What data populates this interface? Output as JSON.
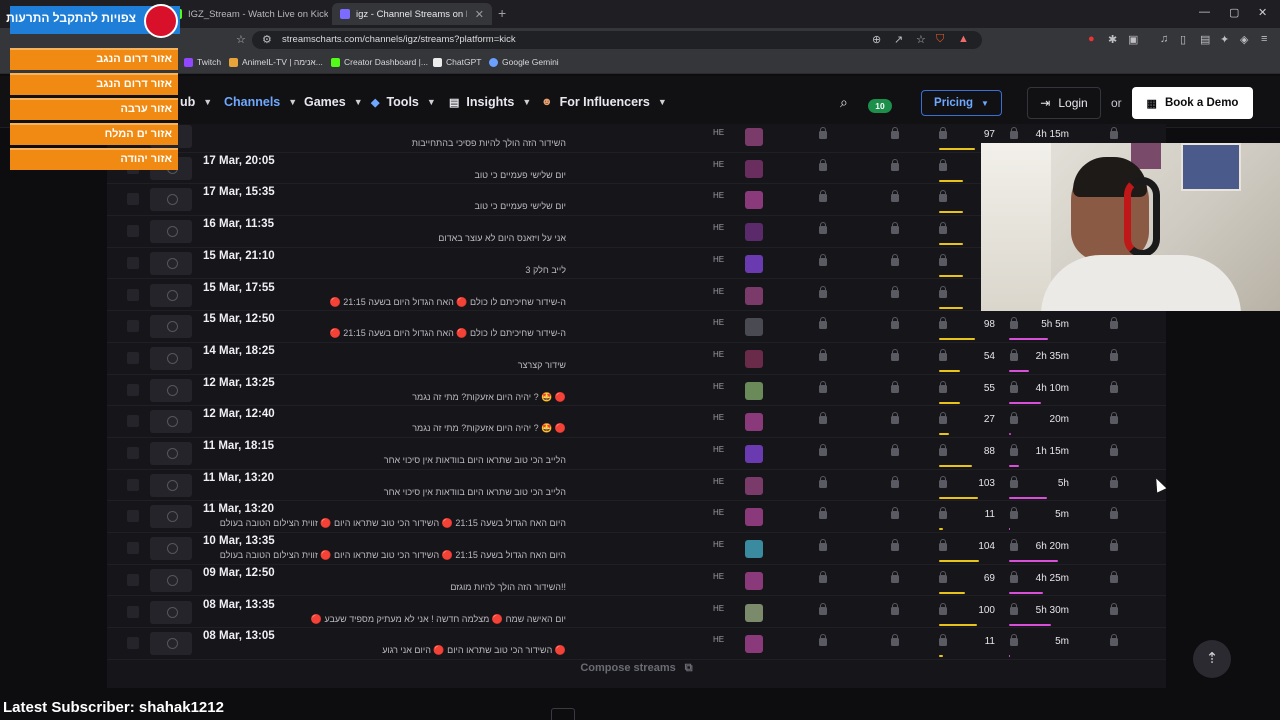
{
  "browser": {
    "tabs": [
      {
        "label": "IGZ_Stream - Watch Live on Kick",
        "active": false,
        "favicon_color": "#53fc18"
      },
      {
        "label": "igz - Channel Streams on Kick V",
        "active": true,
        "favicon_color": "#7b6cff"
      }
    ],
    "url": "streamscharts.com/channels/igz/streams?platform=kick",
    "bookmarks": [
      "Twitch",
      "AnimeIL-TV | אנימה...",
      "Creator Dashboard |...",
      "ChatGPT",
      "Google Gemini"
    ]
  },
  "site_nav": {
    "partial_item": "ub",
    "items": [
      "Channels",
      "Games",
      "Tools",
      "Insights",
      "For Influencers"
    ],
    "active_item": "Channels",
    "notification_count": "10",
    "pricing_label": "Pricing",
    "login_label": "Login",
    "or_label": "or",
    "demo_label": "Book a Demo"
  },
  "table": {
    "rows": [
      {
        "date": "",
        "title": "השידור הזה הולך להיות פסיכי בהתחייבות",
        "lang": "HE",
        "viewers": "97",
        "duration": "4h 15m",
        "avatar": "#7a3a6a",
        "vbar": 0.6,
        "dbar": 0.55
      },
      {
        "date": "17 Mar, 20:05",
        "title": "יום שלישי פעמיים כי טוב",
        "lang": "HE",
        "viewers": "",
        "duration": "",
        "avatar": "#6a2e5e",
        "vbar": 0.4,
        "dbar": 0.3
      },
      {
        "date": "17 Mar, 15:35",
        "title": "יום שלישי פעמיים כי טוב",
        "lang": "HE",
        "viewers": "",
        "duration": "",
        "avatar": "#8a3a7a",
        "vbar": 0.4,
        "dbar": 0.3
      },
      {
        "date": "16 Mar, 11:35",
        "title": "אני על ויזאנס היום לא עוצר באדום",
        "lang": "HE",
        "viewers": "",
        "duration": "",
        "avatar": "#5a2a6a",
        "vbar": 0.4,
        "dbar": 0.3
      },
      {
        "date": "15 Mar, 21:10",
        "title": "לייב חלק 3",
        "lang": "HE",
        "viewers": "",
        "duration": "",
        "avatar": "#6a3ab0",
        "vbar": 0.4,
        "dbar": 0.3
      },
      {
        "date": "15 Mar, 17:55",
        "title": "ה-שידור שחיכיתם לו כולם 🔴 האח הגדול היום בשעה 21:15 🔴",
        "lang": "HE",
        "viewers": "",
        "duration": "",
        "avatar": "#7a3a6a",
        "vbar": 0.4,
        "dbar": 0.3
      },
      {
        "date": "15 Mar, 12:50",
        "title": "ה-שידור שחיכיתם לו כולם 🔴 האח הגדול היום בשעה 21:15 🔴",
        "lang": "HE",
        "viewers": "98",
        "duration": "5h 5m",
        "avatar": "#4a4a52",
        "vbar": 0.6,
        "dbar": 0.65
      },
      {
        "date": "14 Mar, 18:25",
        "title": "שידור קצרצר",
        "lang": "HE",
        "viewers": "54",
        "duration": "2h 35m",
        "avatar": "#6a2a4a",
        "vbar": 0.35,
        "dbar": 0.33
      },
      {
        "date": "12 Mar, 13:25",
        "title": "🔴 🤩 ? יהיה היום אזעקות? מתי זה נגמר",
        "lang": "HE",
        "viewers": "55",
        "duration": "4h 10m",
        "avatar": "#6a8a5a",
        "vbar": 0.35,
        "dbar": 0.53
      },
      {
        "date": "12 Mar, 12:40",
        "title": "🔴 🤩 ? יהיה היום אזעקות? מתי זה נגמר",
        "lang": "HE",
        "viewers": "27",
        "duration": "20m",
        "avatar": "#8a3a7a",
        "vbar": 0.17,
        "dbar": 0.04
      },
      {
        "date": "11 Mar, 18:15",
        "title": "הלייב הכי טוב שתראו היום בוודאות אין סיכוי אחר",
        "lang": "HE",
        "viewers": "88",
        "duration": "1h 15m",
        "avatar": "#6a3ab0",
        "vbar": 0.55,
        "dbar": 0.16
      },
      {
        "date": "11 Mar, 13:20",
        "title": "הלייב הכי טוב שתראו היום בוודאות אין סיכוי אחר",
        "lang": "HE",
        "viewers": "103",
        "duration": "5h",
        "avatar": "#7a3a6a",
        "vbar": 0.65,
        "dbar": 0.64
      },
      {
        "date": "11 Mar, 13:20",
        "title": "היום האח הגדול בשעה 21:15 🔴 השידור הכי טוב שתראו היום 🔴 זווית הצילום הטובה בעולם",
        "lang": "HE",
        "viewers": "11",
        "duration": "5m",
        "avatar": "#8a3a7a",
        "vbar": 0.07,
        "dbar": 0.01
      },
      {
        "date": "10 Mar, 13:35",
        "title": "היום האח הגדול בשעה 21:15 🔴 השידור הכי טוב שתראו היום 🔴 זווית הצילום הטובה בעולם",
        "lang": "HE",
        "viewers": "104",
        "duration": "6h 20m",
        "avatar": "#3a8aa0",
        "vbar": 0.66,
        "dbar": 0.81
      },
      {
        "date": "09 Mar, 12:50",
        "title": "!!השידור הזה הולך להיות מוגזם",
        "lang": "HE",
        "viewers": "69",
        "duration": "4h 25m",
        "avatar": "#8a3a7a",
        "vbar": 0.44,
        "dbar": 0.56
      },
      {
        "date": "08 Mar, 13:35",
        "title": "יום האישה שמח 🔴 מצלמה חדשה ! אני לא מעתיק מספיד שעבע 🔴",
        "lang": "HE",
        "viewers": "100",
        "duration": "5h 30m",
        "avatar": "#7a8a6a",
        "vbar": 0.63,
        "dbar": 0.7
      },
      {
        "date": "08 Mar, 13:05",
        "title": "🔴 השידור הכי טוב שתראו היום 🔴 היום אני רגוע",
        "lang": "HE",
        "viewers": "11",
        "duration": "5m",
        "avatar": "#8a3a7a",
        "vbar": 0.07,
        "dbar": 0.01
      }
    ],
    "compose_label": "Compose streams"
  },
  "overlay": {
    "news_header": "צפויות להתקבל התרעות",
    "regions": [
      "אזור דרום הנגב",
      "אזור דרום הנגב",
      "אזור ערבה",
      "אזור ים המלח",
      "אזור יהודה"
    ],
    "subscriber_text": "Latest Subscriber: shahak1212"
  },
  "icons": [
    "search-icon",
    "lock-icon",
    "play-icon",
    "scroll-top-icon",
    "login-icon",
    "calendar-icon"
  ]
}
